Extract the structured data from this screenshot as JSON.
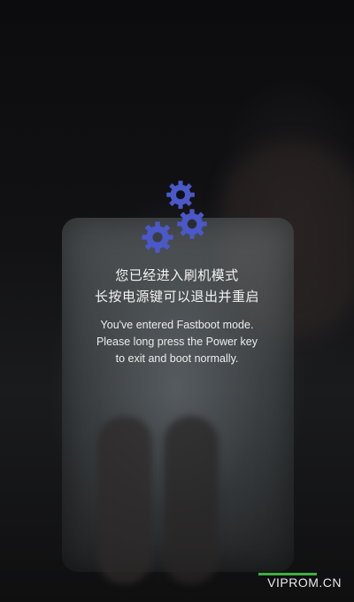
{
  "screen": {
    "message_cn_line1": "您已经进入刷机模式",
    "message_cn_line2": "长按电源键可以退出并重启",
    "message_en_line1": "You've entered Fastboot mode.",
    "message_en_line2": "Please long press the Power key",
    "message_en_line3": "to exit and boot normally."
  },
  "icons": {
    "gears": "gear-icon",
    "gear_color": "#4a58c8"
  },
  "watermark": {
    "text": "VIPROM.CN",
    "accent_color": "#3fae3f"
  }
}
